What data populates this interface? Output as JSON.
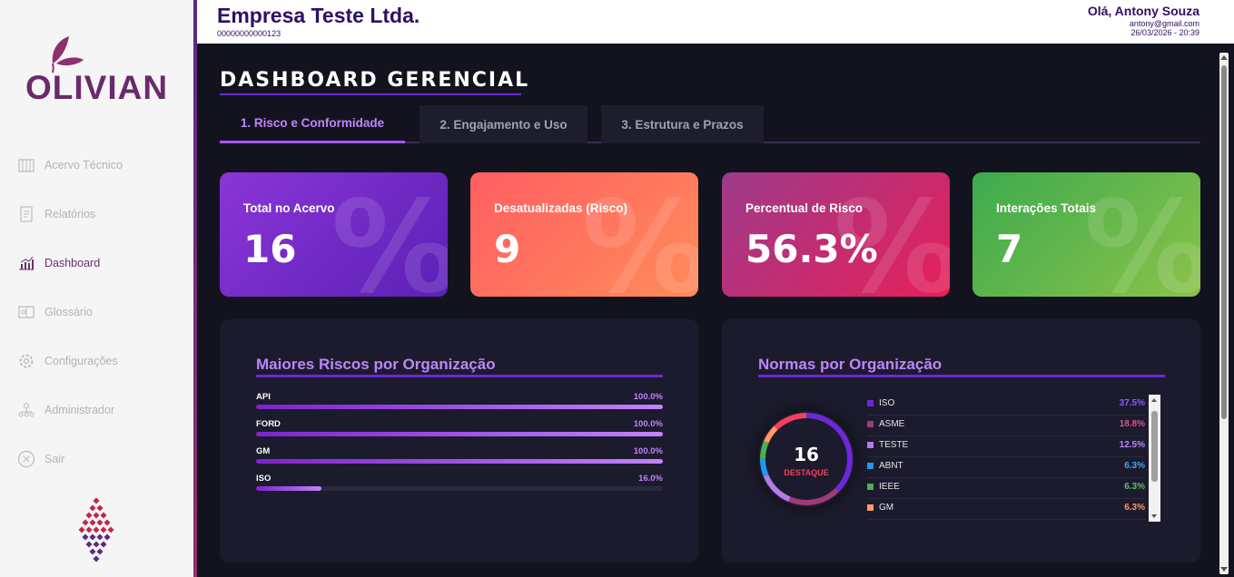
{
  "sidebar": {
    "logo_text": "OLIVIAN",
    "items": [
      {
        "label": "Acervo Técnico",
        "icon": "library-icon",
        "active": false
      },
      {
        "label": "Relatórios",
        "icon": "report-icon",
        "active": false
      },
      {
        "label": "Dashboard",
        "icon": "chart-icon",
        "active": true
      },
      {
        "label": "Glossário",
        "icon": "glossary-icon",
        "active": false
      },
      {
        "label": "Configurações",
        "icon": "gear-icon",
        "active": false
      },
      {
        "label": "Administrador",
        "icon": "admin-icon",
        "active": false
      },
      {
        "label": "Sair",
        "icon": "close-circle-icon",
        "active": false
      }
    ]
  },
  "header": {
    "company_name": "Empresa Teste Ltda.",
    "company_id": "00000000000123",
    "greeting": "Olá, Antony Souza",
    "email": "antony@gmail.com",
    "datetime": "26/03/2026 - 20:39"
  },
  "main": {
    "title": "DASHBOARD GERENCIAL",
    "tabs": [
      {
        "label": "1. Risco e Conformidade",
        "active": true
      },
      {
        "label": "2. Engajamento e Uso",
        "active": false
      },
      {
        "label": "3. Estrutura e Prazos",
        "active": false
      }
    ],
    "kpis": [
      {
        "label": "Total no Acervo",
        "value": "16",
        "gradient": [
          "#7b2fd6",
          "#5b21b6"
        ]
      },
      {
        "label": "Desatualizadas (Risco)",
        "value": "9",
        "gradient": [
          "#ff5e62",
          "#ff9966"
        ]
      },
      {
        "label": "Percentual de Risco",
        "value": "56.3%",
        "gradient": [
          "#9d3a8a",
          "#e0205a"
        ]
      },
      {
        "label": "Interações Totais",
        "value": "7",
        "gradient": [
          "#4caf50",
          "#8bc34a"
        ]
      }
    ],
    "risks_panel": {
      "title": "Maiores Riscos por Organização",
      "rows": [
        {
          "name": "API",
          "pct_label": "100.0%",
          "value": 100
        },
        {
          "name": "FORD",
          "pct_label": "100.0%",
          "value": 100
        },
        {
          "name": "GM",
          "pct_label": "100.0%",
          "value": 100
        },
        {
          "name": "ISO",
          "pct_label": "16.0%",
          "value": 16
        }
      ]
    },
    "norms_panel": {
      "title": "Normas por Organização",
      "center_value": "16",
      "center_label": "DESTAQUE",
      "legend": [
        {
          "name": "ISO",
          "pct_label": "37.5%",
          "value": 37.5,
          "color": "#6d28d9",
          "text_color": "#8b5cf6"
        },
        {
          "name": "ASME",
          "pct_label": "18.8%",
          "value": 18.8,
          "color": "#9d3a7a",
          "text_color": "#e0508a"
        },
        {
          "name": "TESTE",
          "pct_label": "12.5%",
          "value": 12.5,
          "color": "#b57be8",
          "text_color": "#c084fc"
        },
        {
          "name": "ABNT",
          "pct_label": "6.3%",
          "value": 6.3,
          "color": "#2196f3",
          "text_color": "#42a5f5"
        },
        {
          "name": "IEEE",
          "pct_label": "6.3%",
          "value": 6.3,
          "color": "#4caf50",
          "text_color": "#66bb6a"
        },
        {
          "name": "GM",
          "pct_label": "6.3%",
          "value": 6.3,
          "color": "#ff9966",
          "text_color": "#ff9966"
        },
        {
          "name": "",
          "pct_label": "",
          "value": 12.3,
          "color": "#f43f5e",
          "text_color": "#f43f5e"
        }
      ]
    }
  }
}
